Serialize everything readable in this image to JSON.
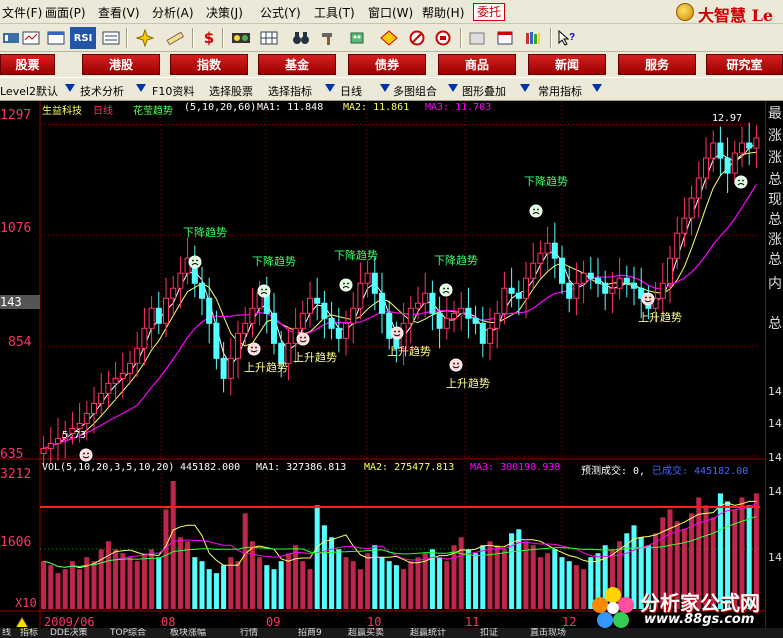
{
  "menu": {
    "items": [
      "文件(F)",
      "画面(P)",
      "查看(V)",
      "分析(A)",
      "决策(J)",
      "公式(Y)",
      "工具(T)",
      "窗口(W)",
      "帮助(H)"
    ],
    "entrust": "委托",
    "brand": "大智慧 Le"
  },
  "nav": {
    "items": [
      "股票",
      "港股",
      "指数",
      "基金",
      "债券",
      "商品",
      "新闻",
      "服务",
      "研究室"
    ]
  },
  "subbar": {
    "items": [
      "Level2默认",
      "技术分析",
      "F10资料",
      "选择股票",
      "选择指标",
      "日线",
      "多图组合",
      "图形叠加",
      "常用指标"
    ]
  },
  "price_chart": {
    "stock_name": "生益科技",
    "period": "日线",
    "indicator": "花莹趋势",
    "params": "(5,10,20,60)",
    "ma1": "MA1: 11.848",
    "ma2": "MA2: 11.861",
    "ma3": "MA3: 11.703",
    "y_labels": [
      "1297",
      "1076",
      "854",
      "635"
    ],
    "price_marker": "143",
    "high_label": "12.97",
    "low_label": "5.73",
    "up_label": "上升趋势",
    "down_label": "下降趋势"
  },
  "volume_chart": {
    "header": "VOL(5,10,20,3,5,10,20)",
    "value": "445182.000",
    "ma1": "MA1: 327386.813",
    "ma2": "MA2: 275477.813",
    "ma3": "MA3: 300198.938",
    "forecast": "预测成交: 0,",
    "traded": "已成交: 445182.00",
    "y_labels": [
      "3212",
      "1606"
    ],
    "unit": "X10",
    "date_labels": [
      "2009/06",
      "08",
      "09",
      "10",
      "11",
      "12"
    ]
  },
  "right_panel": {
    "chars": [
      "最",
      "涨",
      "涨",
      "总",
      "现",
      "总",
      "涨",
      "总",
      "内",
      "总"
    ],
    "nums": [
      "14",
      "14",
      "14",
      "14",
      "14"
    ]
  },
  "footer": {
    "tabs": [
      "线",
      "指标",
      "DDE决策",
      "TOP综合",
      "板块涨幅",
      "行情",
      "招商9",
      "超赢买卖",
      "超赢统计",
      "扣证",
      "直击现场"
    ]
  },
  "site": {
    "title": "分析家公式网",
    "url": "www.88gs.com"
  },
  "colors": {
    "up": "#ff3366",
    "down": "#54ffff",
    "ma_white": "#ffffff",
    "ma_yellow": "#ffff66",
    "ma_magenta": "#ff00ff",
    "grid_red": "#990000"
  },
  "chart_data": {
    "type": "candlestick",
    "y_axis_ticks": [
      6.35,
      8.54,
      10.76,
      12.97
    ],
    "y_range": [
      6.35,
      13.2
    ],
    "high": 12.97,
    "low": 5.73,
    "closes": [
      6.5,
      6.6,
      6.7,
      6.8,
      6.9,
      7.0,
      7.2,
      7.4,
      7.6,
      7.8,
      7.9,
      8.0,
      8.2,
      8.5,
      8.9,
      9.3,
      9.0,
      9.5,
      9.7,
      10.0,
      10.3,
      9.8,
      9.5,
      9.0,
      8.3,
      7.9,
      8.3,
      8.8,
      9.0,
      9.3,
      9.6,
      9.2,
      8.6,
      8.2,
      8.6,
      8.9,
      9.2,
      9.5,
      9.4,
      9.1,
      8.9,
      8.7,
      9.0,
      9.3,
      9.8,
      10.0,
      9.6,
      9.2,
      8.7,
      8.5,
      9.0,
      9.3,
      9.4,
      9.6,
      9.2,
      8.9,
      9.1,
      9.2,
      9.3,
      9.1,
      9.0,
      8.6,
      8.9,
      9.2,
      9.7,
      9.6,
      9.5,
      9.9,
      10.2,
      10.4,
      10.6,
      10.3,
      9.8,
      9.5,
      9.8,
      10.0,
      9.9,
      9.8,
      9.6,
      9.7,
      9.9,
      9.8,
      9.7,
      9.5,
      9.3,
      9.5,
      9.8,
      10.3,
      10.8,
      11.1,
      11.5,
      11.9,
      12.3,
      12.6,
      12.3,
      12.0,
      12.4,
      12.6,
      12.5,
      12.7
    ],
    "volumes": [
      1200,
      1100,
      900,
      1000,
      1200,
      1000,
      1300,
      1200,
      1500,
      1700,
      1500,
      1400,
      1300,
      1200,
      1400,
      1500,
      1300,
      2500,
      3212,
      1800,
      1700,
      1300,
      1200,
      1000,
      900,
      1100,
      1300,
      1200,
      2400,
      1700,
      1300,
      1100,
      1000,
      1200,
      1400,
      1600,
      1200,
      1000,
      2600,
      2100,
      1800,
      1500,
      1300,
      1200,
      1000,
      1400,
      1600,
      1300,
      1200,
      1100,
      1000,
      1200,
      1300,
      1400,
      1500,
      1300,
      1200,
      1600,
      1800,
      1500,
      1400,
      1600,
      1700,
      1600,
      1500,
      1900,
      2000,
      1700,
      1600,
      1300,
      1400,
      1500,
      1300,
      1200,
      1100,
      1000,
      1300,
      1400,
      1600,
      1500,
      1700,
      1900,
      2100,
      1800,
      1600,
      1900,
      2300,
      2500,
      2200,
      2000,
      2400,
      2800,
      2600,
      2300,
      2900,
      2700,
      2500,
      2800,
      2600,
      2900
    ]
  }
}
